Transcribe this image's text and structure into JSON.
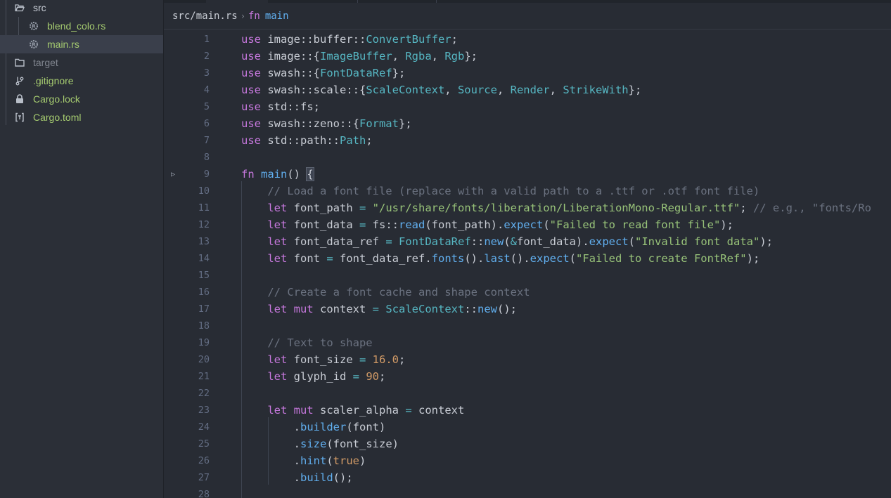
{
  "file_tree": [
    {
      "label": "src",
      "icon": "folder-open-icon",
      "depth": 0,
      "color": "#c8cdd6",
      "selected": false
    },
    {
      "label": "blend_colo.rs",
      "icon": "rust-file-icon",
      "depth": 1,
      "color": "#a6cc70",
      "selected": false
    },
    {
      "label": "main.rs",
      "icon": "rust-file-icon",
      "depth": 1,
      "color": "#a6cc70",
      "selected": true
    },
    {
      "label": "target",
      "icon": "folder-icon",
      "depth": 0,
      "color": "#7f848e",
      "selected": false
    },
    {
      "label": ".gitignore",
      "icon": "git-icon",
      "depth": 0,
      "color": "#a6cc70",
      "selected": false
    },
    {
      "label": "Cargo.lock",
      "icon": "lock-icon",
      "depth": 0,
      "color": "#a6cc70",
      "selected": false
    },
    {
      "label": "Cargo.toml",
      "icon": "toml-icon",
      "depth": 0,
      "color": "#a6cc70",
      "selected": false
    }
  ],
  "breadcrumb": {
    "path": "src/main.rs",
    "separator": "›",
    "symbol_kind": "fn",
    "symbol_name": "main"
  },
  "code_lines": [
    {
      "n": "1",
      "tokens": [
        [
          "kw",
          "use"
        ],
        [
          "plain",
          " image::buffer::"
        ],
        [
          "type",
          "ConvertBuffer"
        ],
        [
          "punct",
          ";"
        ]
      ]
    },
    {
      "n": "2",
      "tokens": [
        [
          "kw",
          "use"
        ],
        [
          "plain",
          " image::{"
        ],
        [
          "type",
          "ImageBuffer"
        ],
        [
          "punct",
          ", "
        ],
        [
          "type",
          "Rgba"
        ],
        [
          "punct",
          ", "
        ],
        [
          "type",
          "Rgb"
        ],
        [
          "punct",
          "};"
        ]
      ]
    },
    {
      "n": "3",
      "tokens": [
        [
          "kw",
          "use"
        ],
        [
          "plain",
          " swash::{"
        ],
        [
          "type",
          "FontDataRef"
        ],
        [
          "punct",
          "};"
        ]
      ]
    },
    {
      "n": "4",
      "tokens": [
        [
          "kw",
          "use"
        ],
        [
          "plain",
          " swash::scale::{"
        ],
        [
          "type",
          "ScaleContext"
        ],
        [
          "punct",
          ", "
        ],
        [
          "type",
          "Source"
        ],
        [
          "punct",
          ", "
        ],
        [
          "type",
          "Render"
        ],
        [
          "punct",
          ", "
        ],
        [
          "type",
          "StrikeWith"
        ],
        [
          "punct",
          "};"
        ]
      ]
    },
    {
      "n": "5",
      "tokens": [
        [
          "kw",
          "use"
        ],
        [
          "plain",
          " std::fs;"
        ]
      ]
    },
    {
      "n": "6",
      "tokens": [
        [
          "kw",
          "use"
        ],
        [
          "plain",
          " swash::zeno::{"
        ],
        [
          "type",
          "Format"
        ],
        [
          "punct",
          "};"
        ]
      ]
    },
    {
      "n": "7",
      "tokens": [
        [
          "kw",
          "use"
        ],
        [
          "plain",
          " std::path::"
        ],
        [
          "type",
          "Path"
        ],
        [
          "punct",
          ";"
        ]
      ]
    },
    {
      "n": "8",
      "tokens": []
    },
    {
      "n": "9",
      "fold": true,
      "tokens": [
        [
          "kw",
          "fn"
        ],
        [
          "plain",
          " "
        ],
        [
          "fn",
          "main"
        ],
        [
          "punct",
          "() "
        ],
        [
          "bracket",
          "{"
        ]
      ]
    },
    {
      "n": "10",
      "tokens": [
        [
          "plain",
          "    "
        ],
        [
          "cmt",
          "// Load a font file (replace with a valid path to a .ttf or .otf font file)"
        ]
      ]
    },
    {
      "n": "11",
      "tokens": [
        [
          "plain",
          "    "
        ],
        [
          "kw",
          "let"
        ],
        [
          "plain",
          " font_path "
        ],
        [
          "op",
          "="
        ],
        [
          "plain",
          " "
        ],
        [
          "str",
          "\"/usr/share/fonts/liberation/LiberationMono-Regular.ttf\""
        ],
        [
          "punct",
          "; "
        ],
        [
          "cmt",
          "// e.g., \"fonts/Ro"
        ]
      ]
    },
    {
      "n": "12",
      "tokens": [
        [
          "plain",
          "    "
        ],
        [
          "kw",
          "let"
        ],
        [
          "plain",
          " font_data "
        ],
        [
          "op",
          "="
        ],
        [
          "plain",
          " fs::"
        ],
        [
          "fn",
          "read"
        ],
        [
          "punct",
          "(font_path)."
        ],
        [
          "fn",
          "expect"
        ],
        [
          "punct",
          "("
        ],
        [
          "str",
          "\"Failed to read font file\""
        ],
        [
          "punct",
          ");"
        ]
      ]
    },
    {
      "n": "13",
      "tokens": [
        [
          "plain",
          "    "
        ],
        [
          "kw",
          "let"
        ],
        [
          "plain",
          " font_data_ref "
        ],
        [
          "op",
          "="
        ],
        [
          "plain",
          " "
        ],
        [
          "type",
          "FontDataRef"
        ],
        [
          "plain",
          "::"
        ],
        [
          "fn",
          "new"
        ],
        [
          "punct",
          "("
        ],
        [
          "op",
          "&"
        ],
        [
          "plain",
          "font_data)."
        ],
        [
          "fn",
          "expect"
        ],
        [
          "punct",
          "("
        ],
        [
          "str",
          "\"Invalid font data\""
        ],
        [
          "punct",
          ");"
        ]
      ]
    },
    {
      "n": "14",
      "tokens": [
        [
          "plain",
          "    "
        ],
        [
          "kw",
          "let"
        ],
        [
          "plain",
          " font "
        ],
        [
          "op",
          "="
        ],
        [
          "plain",
          " font_data_ref."
        ],
        [
          "fn",
          "fonts"
        ],
        [
          "punct",
          "()."
        ],
        [
          "fn",
          "last"
        ],
        [
          "punct",
          "()."
        ],
        [
          "fn",
          "expect"
        ],
        [
          "punct",
          "("
        ],
        [
          "str",
          "\"Failed to create FontRef\""
        ],
        [
          "punct",
          ");"
        ]
      ]
    },
    {
      "n": "15",
      "tokens": []
    },
    {
      "n": "16",
      "tokens": [
        [
          "plain",
          "    "
        ],
        [
          "cmt",
          "// Create a font cache and shape context"
        ]
      ]
    },
    {
      "n": "17",
      "tokens": [
        [
          "plain",
          "    "
        ],
        [
          "kw",
          "let"
        ],
        [
          "plain",
          " "
        ],
        [
          "kw",
          "mut"
        ],
        [
          "plain",
          " context "
        ],
        [
          "op",
          "="
        ],
        [
          "plain",
          " "
        ],
        [
          "type",
          "ScaleContext"
        ],
        [
          "plain",
          "::"
        ],
        [
          "fn",
          "new"
        ],
        [
          "punct",
          "();"
        ]
      ]
    },
    {
      "n": "18",
      "tokens": []
    },
    {
      "n": "19",
      "tokens": [
        [
          "plain",
          "    "
        ],
        [
          "cmt",
          "// Text to shape"
        ]
      ]
    },
    {
      "n": "20",
      "tokens": [
        [
          "plain",
          "    "
        ],
        [
          "kw",
          "let"
        ],
        [
          "plain",
          " font_size "
        ],
        [
          "op",
          "="
        ],
        [
          "plain",
          " "
        ],
        [
          "num",
          "16.0"
        ],
        [
          "punct",
          ";"
        ]
      ]
    },
    {
      "n": "21",
      "tokens": [
        [
          "plain",
          "    "
        ],
        [
          "kw",
          "let"
        ],
        [
          "plain",
          " glyph_id "
        ],
        [
          "op",
          "="
        ],
        [
          "plain",
          " "
        ],
        [
          "num",
          "90"
        ],
        [
          "punct",
          ";"
        ]
      ]
    },
    {
      "n": "22",
      "tokens": []
    },
    {
      "n": "23",
      "tokens": [
        [
          "plain",
          "    "
        ],
        [
          "kw",
          "let"
        ],
        [
          "plain",
          " "
        ],
        [
          "kw",
          "mut"
        ],
        [
          "plain",
          " scaler_alpha "
        ],
        [
          "op",
          "="
        ],
        [
          "plain",
          " context"
        ]
      ]
    },
    {
      "n": "24",
      "tokens": [
        [
          "plain",
          "        "
        ],
        [
          "punct",
          "."
        ],
        [
          "fn",
          "builder"
        ],
        [
          "punct",
          "(font)"
        ]
      ]
    },
    {
      "n": "25",
      "tokens": [
        [
          "plain",
          "        "
        ],
        [
          "punct",
          "."
        ],
        [
          "fn",
          "size"
        ],
        [
          "punct",
          "(font_size)"
        ]
      ]
    },
    {
      "n": "26",
      "tokens": [
        [
          "plain",
          "        "
        ],
        [
          "punct",
          "."
        ],
        [
          "fn",
          "hint"
        ],
        [
          "punct",
          "("
        ],
        [
          "num",
          "true"
        ],
        [
          "punct",
          ")"
        ]
      ]
    },
    {
      "n": "27",
      "tokens": [
        [
          "plain",
          "        "
        ],
        [
          "punct",
          "."
        ],
        [
          "fn",
          "build"
        ],
        [
          "punct",
          "();"
        ]
      ]
    },
    {
      "n": "28",
      "tokens": []
    }
  ],
  "colors": {
    "background": "#282c34",
    "sidebar": "#2b2f37",
    "selection": "#3a3f4b",
    "keyword": "#c678dd",
    "type": "#56b6c2",
    "function": "#61afef",
    "string": "#98c379",
    "number": "#d19a66",
    "comment": "#6b7280"
  }
}
